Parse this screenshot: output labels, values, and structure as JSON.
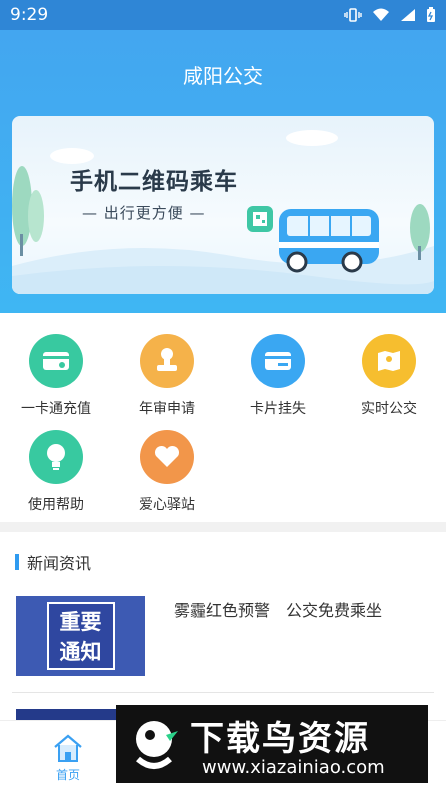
{
  "status": {
    "time": "9:29"
  },
  "header": {
    "title": "咸阳公交"
  },
  "banner": {
    "headline": "手机二维码乘车",
    "subtitle": "— 出行更方便 —"
  },
  "services": [
    {
      "label": "一卡通充值",
      "color": "#38c9a0",
      "icon": "card-recharge-icon"
    },
    {
      "label": "年审申请",
      "color": "#f5b24a",
      "icon": "stamp-icon"
    },
    {
      "label": "卡片挂失",
      "color": "#3aa7f2",
      "icon": "card-lost-icon"
    },
    {
      "label": "实时公交",
      "color": "#f6be2f",
      "icon": "map-icon"
    },
    {
      "label": "使用帮助",
      "color": "#38c9a0",
      "icon": "lightbulb-icon"
    },
    {
      "label": "爱心驿站",
      "color": "#f2964a",
      "icon": "heart-icon"
    }
  ],
  "news": {
    "section_title": "新闻资讯",
    "items": [
      {
        "thumb_text_1": "重要",
        "thumb_text_2": "通知",
        "title": "雾霾红色预警　公交免费乘坐"
      }
    ]
  },
  "tabbar": {
    "home_label": "首页"
  },
  "ad": {
    "brand": "下载鸟资源",
    "url": "www.xiazainiao.com"
  }
}
